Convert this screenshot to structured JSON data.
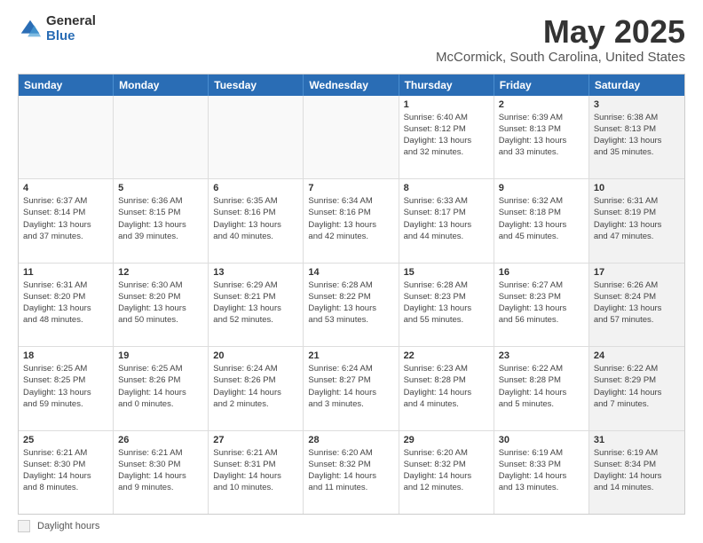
{
  "logo": {
    "general": "General",
    "blue": "Blue"
  },
  "header": {
    "title": "May 2025",
    "subtitle": "McCormick, South Carolina, United States"
  },
  "days_of_week": [
    "Sunday",
    "Monday",
    "Tuesday",
    "Wednesday",
    "Thursday",
    "Friday",
    "Saturday"
  ],
  "legend": {
    "box_label": "Daylight hours"
  },
  "weeks": [
    [
      {
        "day": "",
        "info": "",
        "empty": true
      },
      {
        "day": "",
        "info": "",
        "empty": true
      },
      {
        "day": "",
        "info": "",
        "empty": true
      },
      {
        "day": "",
        "info": "",
        "empty": true
      },
      {
        "day": "1",
        "info": "Sunrise: 6:40 AM\nSunset: 8:12 PM\nDaylight: 13 hours\nand 32 minutes."
      },
      {
        "day": "2",
        "info": "Sunrise: 6:39 AM\nSunset: 8:13 PM\nDaylight: 13 hours\nand 33 minutes."
      },
      {
        "day": "3",
        "info": "Sunrise: 6:38 AM\nSunset: 8:13 PM\nDaylight: 13 hours\nand 35 minutes.",
        "shaded": true
      }
    ],
    [
      {
        "day": "4",
        "info": "Sunrise: 6:37 AM\nSunset: 8:14 PM\nDaylight: 13 hours\nand 37 minutes."
      },
      {
        "day": "5",
        "info": "Sunrise: 6:36 AM\nSunset: 8:15 PM\nDaylight: 13 hours\nand 39 minutes."
      },
      {
        "day": "6",
        "info": "Sunrise: 6:35 AM\nSunset: 8:16 PM\nDaylight: 13 hours\nand 40 minutes."
      },
      {
        "day": "7",
        "info": "Sunrise: 6:34 AM\nSunset: 8:16 PM\nDaylight: 13 hours\nand 42 minutes."
      },
      {
        "day": "8",
        "info": "Sunrise: 6:33 AM\nSunset: 8:17 PM\nDaylight: 13 hours\nand 44 minutes."
      },
      {
        "day": "9",
        "info": "Sunrise: 6:32 AM\nSunset: 8:18 PM\nDaylight: 13 hours\nand 45 minutes."
      },
      {
        "day": "10",
        "info": "Sunrise: 6:31 AM\nSunset: 8:19 PM\nDaylight: 13 hours\nand 47 minutes.",
        "shaded": true
      }
    ],
    [
      {
        "day": "11",
        "info": "Sunrise: 6:31 AM\nSunset: 8:20 PM\nDaylight: 13 hours\nand 48 minutes."
      },
      {
        "day": "12",
        "info": "Sunrise: 6:30 AM\nSunset: 8:20 PM\nDaylight: 13 hours\nand 50 minutes."
      },
      {
        "day": "13",
        "info": "Sunrise: 6:29 AM\nSunset: 8:21 PM\nDaylight: 13 hours\nand 52 minutes."
      },
      {
        "day": "14",
        "info": "Sunrise: 6:28 AM\nSunset: 8:22 PM\nDaylight: 13 hours\nand 53 minutes."
      },
      {
        "day": "15",
        "info": "Sunrise: 6:28 AM\nSunset: 8:23 PM\nDaylight: 13 hours\nand 55 minutes."
      },
      {
        "day": "16",
        "info": "Sunrise: 6:27 AM\nSunset: 8:23 PM\nDaylight: 13 hours\nand 56 minutes."
      },
      {
        "day": "17",
        "info": "Sunrise: 6:26 AM\nSunset: 8:24 PM\nDaylight: 13 hours\nand 57 minutes.",
        "shaded": true
      }
    ],
    [
      {
        "day": "18",
        "info": "Sunrise: 6:25 AM\nSunset: 8:25 PM\nDaylight: 13 hours\nand 59 minutes."
      },
      {
        "day": "19",
        "info": "Sunrise: 6:25 AM\nSunset: 8:26 PM\nDaylight: 14 hours\nand 0 minutes."
      },
      {
        "day": "20",
        "info": "Sunrise: 6:24 AM\nSunset: 8:26 PM\nDaylight: 14 hours\nand 2 minutes."
      },
      {
        "day": "21",
        "info": "Sunrise: 6:24 AM\nSunset: 8:27 PM\nDaylight: 14 hours\nand 3 minutes."
      },
      {
        "day": "22",
        "info": "Sunrise: 6:23 AM\nSunset: 8:28 PM\nDaylight: 14 hours\nand 4 minutes."
      },
      {
        "day": "23",
        "info": "Sunrise: 6:22 AM\nSunset: 8:28 PM\nDaylight: 14 hours\nand 5 minutes."
      },
      {
        "day": "24",
        "info": "Sunrise: 6:22 AM\nSunset: 8:29 PM\nDaylight: 14 hours\nand 7 minutes.",
        "shaded": true
      }
    ],
    [
      {
        "day": "25",
        "info": "Sunrise: 6:21 AM\nSunset: 8:30 PM\nDaylight: 14 hours\nand 8 minutes."
      },
      {
        "day": "26",
        "info": "Sunrise: 6:21 AM\nSunset: 8:30 PM\nDaylight: 14 hours\nand 9 minutes."
      },
      {
        "day": "27",
        "info": "Sunrise: 6:21 AM\nSunset: 8:31 PM\nDaylight: 14 hours\nand 10 minutes."
      },
      {
        "day": "28",
        "info": "Sunrise: 6:20 AM\nSunset: 8:32 PM\nDaylight: 14 hours\nand 11 minutes."
      },
      {
        "day": "29",
        "info": "Sunrise: 6:20 AM\nSunset: 8:32 PM\nDaylight: 14 hours\nand 12 minutes."
      },
      {
        "day": "30",
        "info": "Sunrise: 6:19 AM\nSunset: 8:33 PM\nDaylight: 14 hours\nand 13 minutes."
      },
      {
        "day": "31",
        "info": "Sunrise: 6:19 AM\nSunset: 8:34 PM\nDaylight: 14 hours\nand 14 minutes.",
        "shaded": true
      }
    ]
  ]
}
